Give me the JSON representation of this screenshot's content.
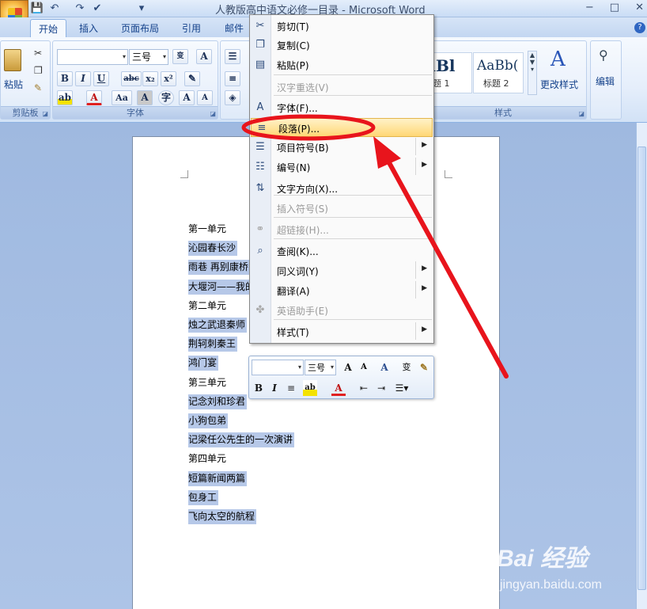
{
  "window": {
    "title": "人教版高中语文必修一目录 - Microsoft Word",
    "min": "−",
    "max": "□",
    "close": "✕"
  },
  "tabs": [
    {
      "label": "开始"
    },
    {
      "label": "插入"
    },
    {
      "label": "页面布局"
    },
    {
      "label": "引用"
    },
    {
      "label": "邮件"
    }
  ],
  "help_label": "?",
  "ribbon": {
    "clipboard": {
      "paste_label": "粘贴",
      "group_label": "剪贴板"
    },
    "font": {
      "group_label": "字体",
      "size_value": "三号",
      "bold": "B",
      "italic": "I",
      "underline": "U",
      "strike": "abc",
      "subscript": "x₂",
      "superscript": "x²",
      "change_case": "Aa",
      "grow": "A",
      "shrink": "A"
    },
    "styles": {
      "group_label": "样式",
      "items": [
        {
          "preview": "aBl",
          "label": "标题 1"
        },
        {
          "preview": "AaBb(",
          "label": "标题 2"
        }
      ],
      "change_styles_label": "更改样式",
      "edit_label": "编辑"
    }
  },
  "document": {
    "lines": [
      {
        "text": "第一单元",
        "selected": false
      },
      {
        "text": "沁园春长沙",
        "selected": true
      },
      {
        "text": "雨巷  再别康桥",
        "selected": true
      },
      {
        "text": "大堰河——我的",
        "selected": true
      },
      {
        "text": "第二单元",
        "selected": false
      },
      {
        "text": "烛之武退秦师",
        "selected": true
      },
      {
        "text": "荆轲刺秦王",
        "selected": true
      },
      {
        "text": "鸿门宴",
        "selected": true
      },
      {
        "text": "第三单元",
        "selected": false
      },
      {
        "text": "记念刘和珍君",
        "selected": true
      },
      {
        "text": "小狗包弟",
        "selected": true
      },
      {
        "text": "记梁任公先生的一次演讲",
        "selected": true
      },
      {
        "text": "第四单元",
        "selected": false
      },
      {
        "text": "短篇新闻两篇",
        "selected": true
      },
      {
        "text": "包身工",
        "selected": true
      },
      {
        "text": "飞向太空的航程",
        "selected": true
      }
    ]
  },
  "context_menu": {
    "items": [
      {
        "label": "剪切(T)",
        "icon": "✂",
        "disabled": false,
        "submenu": false
      },
      {
        "label": "复制(C)",
        "icon": "❐",
        "disabled": false,
        "submenu": false
      },
      {
        "label": "粘贴(P)",
        "icon": "▤",
        "disabled": false,
        "submenu": false
      },
      {
        "label": "汉字重选(V)",
        "icon": "",
        "disabled": true,
        "submenu": false
      },
      {
        "label": "字体(F)...",
        "icon": "A",
        "disabled": false,
        "submenu": false
      },
      {
        "label": "段落(P)...",
        "icon": "≡",
        "disabled": false,
        "submenu": false,
        "highlighted": true
      },
      {
        "label": "项目符号(B)",
        "icon": "☰",
        "disabled": false,
        "submenu": true
      },
      {
        "label": "编号(N)",
        "icon": "☷",
        "disabled": false,
        "submenu": true
      },
      {
        "label": "文字方向(X)...",
        "icon": "⇅",
        "disabled": false,
        "submenu": false
      },
      {
        "label": "插入符号(S)",
        "icon": "",
        "disabled": true,
        "submenu": false
      },
      {
        "label": "超链接(H)...",
        "icon": "⚭",
        "disabled": true,
        "submenu": false
      },
      {
        "label": "查阅(K)...",
        "icon": "⌕",
        "disabled": false,
        "submenu": false
      },
      {
        "label": "同义词(Y)",
        "icon": "",
        "disabled": false,
        "submenu": true
      },
      {
        "label": "翻译(A)",
        "icon": "",
        "disabled": false,
        "submenu": true
      },
      {
        "label": "英语助手(E)",
        "icon": "✤",
        "disabled": true,
        "submenu": false
      },
      {
        "label": "样式(T)",
        "icon": "",
        "disabled": false,
        "submenu": true
      }
    ],
    "submenu_arrow": "▶"
  },
  "mini_toolbar": {
    "size_value": "三号",
    "bold": "B",
    "italic": "I"
  },
  "watermark": {
    "brand": "Bai 经验",
    "url": "jingyan.baidu.com"
  },
  "colors": {
    "highlight_ring": "#e8141c",
    "arrow": "#e8141c",
    "menu_highlight": "#ffd775",
    "selection": "#b6c8e8"
  }
}
